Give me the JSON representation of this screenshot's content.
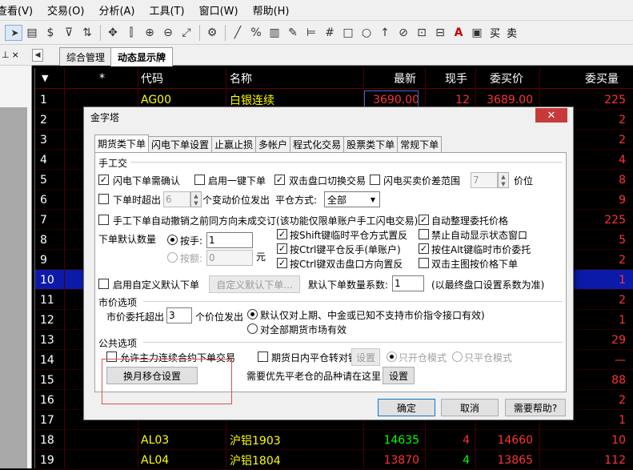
{
  "menu": [
    "查看(V)",
    "交易(O)",
    "分析(A)",
    "工具(T)",
    "窗口(W)",
    "帮助(H)"
  ],
  "toolbar": {
    "buy": "买",
    "sell": "卖"
  },
  "left_pane": {
    "pin": "⊥",
    "close": "×"
  },
  "tabs": [
    "综合管理",
    "动态显示牌"
  ],
  "grid": {
    "headers": [
      "",
      "*",
      "代码",
      "名称",
      "最新",
      "现手",
      "委买价",
      "委买量"
    ],
    "rows": [
      {
        "no": "1",
        "code": "AG00",
        "name": "白银连续",
        "last": "3690.00",
        "vol": "12",
        "bid": "3689.00",
        "bidvol": "225"
      },
      {
        "no": "2",
        "code": "",
        "name": "",
        "last": "",
        "vol": "",
        "bid": "",
        "bidvol": "2"
      },
      {
        "no": "3",
        "code": "",
        "name": "",
        "last": "",
        "vol": "",
        "bid": "",
        "bidvol": "2"
      },
      {
        "no": "4",
        "code": "",
        "name": "",
        "last": "",
        "vol": "",
        "bid": "",
        "bidvol": "4"
      },
      {
        "no": "5",
        "code": "",
        "name": "",
        "last": "",
        "vol": "",
        "bid": "",
        "bidvol": "8"
      },
      {
        "no": "6",
        "code": "",
        "name": "",
        "last": "",
        "vol": "",
        "bid": "",
        "bidvol": "9"
      },
      {
        "no": "7",
        "code": "",
        "name": "",
        "last": "",
        "vol": "",
        "bid": "",
        "bidvol": "225"
      },
      {
        "no": "8",
        "code": "",
        "name": "",
        "last": "",
        "vol": "",
        "bid": "",
        "bidvol": "5"
      },
      {
        "no": "9",
        "code": "",
        "name": "",
        "last": "",
        "vol": "",
        "bid": "",
        "bidvol": "2"
      },
      {
        "no": "10",
        "code": "",
        "name": "",
        "last": "",
        "vol": "",
        "bid": "",
        "bidvol": "1"
      },
      {
        "no": "11",
        "code": "",
        "name": "",
        "last": "",
        "vol": "",
        "bid": "",
        "bidvol": "2"
      },
      {
        "no": "12",
        "code": "",
        "name": "",
        "last": "",
        "vol": "",
        "bid": "",
        "bidvol": "1"
      },
      {
        "no": "13",
        "code": "",
        "name": "",
        "last": "",
        "vol": "",
        "bid": "",
        "bidvol": "29"
      },
      {
        "no": "14",
        "code": "",
        "name": "",
        "last": "",
        "vol": "",
        "bid": "",
        "bidvol": "—"
      },
      {
        "no": "15",
        "code": "",
        "name": "",
        "last": "",
        "vol": "",
        "bid": "",
        "bidvol": "88"
      },
      {
        "no": "16",
        "code": "",
        "name": "",
        "last": "",
        "vol": "",
        "bid": "",
        "bidvol": "2"
      },
      {
        "no": "17",
        "code": "",
        "name": "",
        "last": "",
        "vol": "",
        "bid": "",
        "bidvol": "1"
      },
      {
        "no": "18",
        "code": "AL03",
        "name": "沪铝1903",
        "last": "14635",
        "vol": "4",
        "bid": "14660",
        "bidvol": "10"
      },
      {
        "no": "19",
        "code": "AL04",
        "name": "沪铝1804",
        "last": "13870",
        "vol": "4",
        "bid": "13865",
        "bidvol": "112"
      }
    ]
  },
  "dialog": {
    "title": "金字塔",
    "close": "✕",
    "tabs": [
      "期货类下单",
      "闪电下单设置",
      "止赢止损",
      "多帐户",
      "程式化交易",
      "股票类下单",
      "常规下单"
    ],
    "sec_manual": "手工交",
    "cb_flash_confirm": "闪电下单需确认",
    "cb_one_click": "启用一键下单",
    "cb_dblclick_switch": "双击盘口切换交易",
    "cb_flash_range": "闪电买卖价差范围",
    "flash_range_value": "7",
    "price_unit": "价位",
    "cb_timeout": "下单时超出",
    "timeout_value": "6",
    "timeout_tail": "个变动价位发出",
    "close_method_label": "平仓方式:",
    "close_method_value": "全部",
    "cb_auto_cancel": "手工下单自动撤销之前同方向未成交订(该功能仅限单账户手工闪电交易)",
    "cb_auto_adjust": "自动整理委托价格",
    "default_qty_label": "下单默认数量",
    "rd_hand": "按手:",
    "hand_value": "1",
    "rd_amount": "按额:",
    "amount_value": "0",
    "amount_unit": "元",
    "cb_shift_reverse": "按Shift键临时平仓方式置反",
    "cb_ctrl_close": "按Ctrl键平仓反手(单账户)",
    "cb_ctrl_dbl": "按Ctrl键双击盘口方向置反",
    "cb_disable_status": "禁止自动显示状态窗口",
    "cb_alt_market": "按住Alt键临时市价委托",
    "cb_dblclick_chart": "双击主图按价格下单",
    "cb_custom_default": "启用自定义默认下单",
    "btn_custom_default": "自定义默认下单...",
    "default_coef_label": "默认下单数量系数:",
    "default_coef_value": "1",
    "default_coef_note": "(以最终盘口设置系数为准)",
    "sec_market": "市价选项",
    "market_exceed_label": "市价委托超出",
    "market_exceed_value": "3",
    "market_exceed_tail": "个价位发出",
    "rd_default_only": "默认仅对上期、中金或已知不支持市价指令接口有效)",
    "rd_all_futures": "对全部期货市场有效",
    "sec_public": "公共选项",
    "cb_allow_main": "允许主力连续合约下单交易",
    "cb_intraday_lock": "期货日内平仓转对锁",
    "btn_lock_settings": "设置",
    "rd_open_only": "只开仓模式",
    "rd_close_only": "只平仓模式",
    "btn_roll": "换月移仓设置",
    "priority_close_label": "需要优先平老仓的品种请在这里",
    "btn_priority_settings": "设置",
    "btn_ok": "确定",
    "btn_cancel": "取消",
    "btn_help": "需要帮助?"
  }
}
